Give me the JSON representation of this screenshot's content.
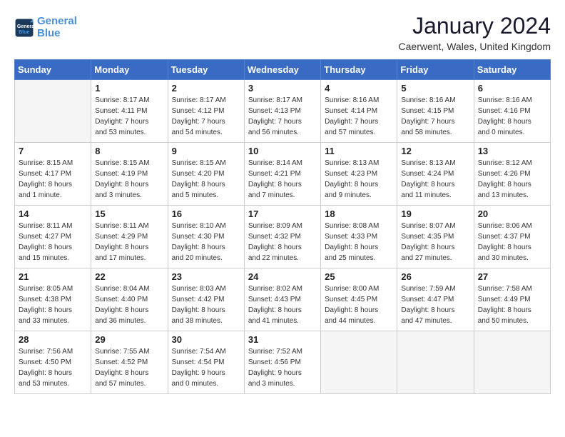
{
  "header": {
    "logo_line1": "General",
    "logo_line2": "Blue",
    "title": "January 2024",
    "subtitle": "Caerwent, Wales, United Kingdom"
  },
  "weekdays": [
    "Sunday",
    "Monday",
    "Tuesday",
    "Wednesday",
    "Thursday",
    "Friday",
    "Saturday"
  ],
  "weeks": [
    [
      {
        "day": "",
        "info": ""
      },
      {
        "day": "1",
        "info": "Sunrise: 8:17 AM\nSunset: 4:11 PM\nDaylight: 7 hours\nand 53 minutes."
      },
      {
        "day": "2",
        "info": "Sunrise: 8:17 AM\nSunset: 4:12 PM\nDaylight: 7 hours\nand 54 minutes."
      },
      {
        "day": "3",
        "info": "Sunrise: 8:17 AM\nSunset: 4:13 PM\nDaylight: 7 hours\nand 56 minutes."
      },
      {
        "day": "4",
        "info": "Sunrise: 8:16 AM\nSunset: 4:14 PM\nDaylight: 7 hours\nand 57 minutes."
      },
      {
        "day": "5",
        "info": "Sunrise: 8:16 AM\nSunset: 4:15 PM\nDaylight: 7 hours\nand 58 minutes."
      },
      {
        "day": "6",
        "info": "Sunrise: 8:16 AM\nSunset: 4:16 PM\nDaylight: 8 hours\nand 0 minutes."
      }
    ],
    [
      {
        "day": "7",
        "info": "Sunrise: 8:15 AM\nSunset: 4:17 PM\nDaylight: 8 hours\nand 1 minute."
      },
      {
        "day": "8",
        "info": "Sunrise: 8:15 AM\nSunset: 4:19 PM\nDaylight: 8 hours\nand 3 minutes."
      },
      {
        "day": "9",
        "info": "Sunrise: 8:15 AM\nSunset: 4:20 PM\nDaylight: 8 hours\nand 5 minutes."
      },
      {
        "day": "10",
        "info": "Sunrise: 8:14 AM\nSunset: 4:21 PM\nDaylight: 8 hours\nand 7 minutes."
      },
      {
        "day": "11",
        "info": "Sunrise: 8:13 AM\nSunset: 4:23 PM\nDaylight: 8 hours\nand 9 minutes."
      },
      {
        "day": "12",
        "info": "Sunrise: 8:13 AM\nSunset: 4:24 PM\nDaylight: 8 hours\nand 11 minutes."
      },
      {
        "day": "13",
        "info": "Sunrise: 8:12 AM\nSunset: 4:26 PM\nDaylight: 8 hours\nand 13 minutes."
      }
    ],
    [
      {
        "day": "14",
        "info": "Sunrise: 8:11 AM\nSunset: 4:27 PM\nDaylight: 8 hours\nand 15 minutes."
      },
      {
        "day": "15",
        "info": "Sunrise: 8:11 AM\nSunset: 4:29 PM\nDaylight: 8 hours\nand 17 minutes."
      },
      {
        "day": "16",
        "info": "Sunrise: 8:10 AM\nSunset: 4:30 PM\nDaylight: 8 hours\nand 20 minutes."
      },
      {
        "day": "17",
        "info": "Sunrise: 8:09 AM\nSunset: 4:32 PM\nDaylight: 8 hours\nand 22 minutes."
      },
      {
        "day": "18",
        "info": "Sunrise: 8:08 AM\nSunset: 4:33 PM\nDaylight: 8 hours\nand 25 minutes."
      },
      {
        "day": "19",
        "info": "Sunrise: 8:07 AM\nSunset: 4:35 PM\nDaylight: 8 hours\nand 27 minutes."
      },
      {
        "day": "20",
        "info": "Sunrise: 8:06 AM\nSunset: 4:37 PM\nDaylight: 8 hours\nand 30 minutes."
      }
    ],
    [
      {
        "day": "21",
        "info": "Sunrise: 8:05 AM\nSunset: 4:38 PM\nDaylight: 8 hours\nand 33 minutes."
      },
      {
        "day": "22",
        "info": "Sunrise: 8:04 AM\nSunset: 4:40 PM\nDaylight: 8 hours\nand 36 minutes."
      },
      {
        "day": "23",
        "info": "Sunrise: 8:03 AM\nSunset: 4:42 PM\nDaylight: 8 hours\nand 38 minutes."
      },
      {
        "day": "24",
        "info": "Sunrise: 8:02 AM\nSunset: 4:43 PM\nDaylight: 8 hours\nand 41 minutes."
      },
      {
        "day": "25",
        "info": "Sunrise: 8:00 AM\nSunset: 4:45 PM\nDaylight: 8 hours\nand 44 minutes."
      },
      {
        "day": "26",
        "info": "Sunrise: 7:59 AM\nSunset: 4:47 PM\nDaylight: 8 hours\nand 47 minutes."
      },
      {
        "day": "27",
        "info": "Sunrise: 7:58 AM\nSunset: 4:49 PM\nDaylight: 8 hours\nand 50 minutes."
      }
    ],
    [
      {
        "day": "28",
        "info": "Sunrise: 7:56 AM\nSunset: 4:50 PM\nDaylight: 8 hours\nand 53 minutes."
      },
      {
        "day": "29",
        "info": "Sunrise: 7:55 AM\nSunset: 4:52 PM\nDaylight: 8 hours\nand 57 minutes."
      },
      {
        "day": "30",
        "info": "Sunrise: 7:54 AM\nSunset: 4:54 PM\nDaylight: 9 hours\nand 0 minutes."
      },
      {
        "day": "31",
        "info": "Sunrise: 7:52 AM\nSunset: 4:56 PM\nDaylight: 9 hours\nand 3 minutes."
      },
      {
        "day": "",
        "info": ""
      },
      {
        "day": "",
        "info": ""
      },
      {
        "day": "",
        "info": ""
      }
    ]
  ]
}
